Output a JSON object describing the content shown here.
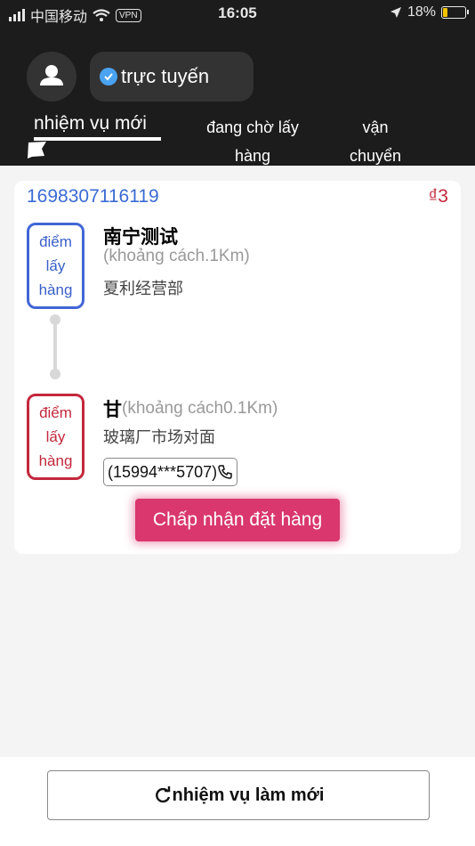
{
  "status_bar": {
    "carrier": "中国移动",
    "vpn": "VPN",
    "time": "16:05",
    "battery": "18%"
  },
  "header": {
    "status_label": "trực tuyến",
    "tabs": [
      {
        "label": "nhiệm vụ mới"
      },
      {
        "label": "đang chờ lấy hàng"
      },
      {
        "label": "vận chuyển"
      }
    ]
  },
  "order": {
    "number": "1698307116119",
    "price": "₫3",
    "pickup": {
      "tag": "điểm lấy hàng",
      "name": "南宁测试",
      "distance": "(khoảng cách.1Km)",
      "address": "夏利经营部"
    },
    "dropoff": {
      "tag": "điểm lấy hàng",
      "name": "甘",
      "distance": "(khoảng cách0.1Km)",
      "address": "玻璃厂市场对面",
      "phone": "(15994***5707)"
    },
    "accept_label": "Chấp nhận đặt hàng"
  },
  "footer": {
    "refresh_label": "nhiệm vụ làm mới"
  },
  "colors": {
    "header_bg": "#1c1c1c",
    "blue": "#3a6bd3",
    "red": "#c3283c",
    "accept": "#d9376e"
  },
  "icons": [
    "user-icon",
    "check-icon",
    "flag-icon",
    "phone-icon",
    "refresh-icon",
    "signal-icon",
    "wifi-icon",
    "location-arrow-icon",
    "battery-icon"
  ]
}
